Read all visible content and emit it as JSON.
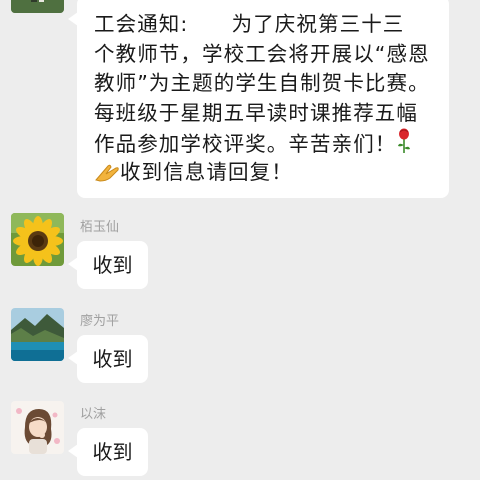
{
  "messages": [
    {
      "sender": "",
      "avatar_icon": "person-outdoor-photo",
      "lines": [
        "工会通知:　　为了庆祝第三十三",
        "个教师节，学校工会将开展以“感恩",
        "教师”为主题的学生自制贺卡比赛。",
        "每班级于星期五早读时课推荐五幅",
        "作品参加学校评奖。辛苦亲们！"
      ],
      "last_line": "收到信息请回复！",
      "emoji_rose": "rose-emoji",
      "emoji_hands": "folded-hands-emoji"
    },
    {
      "sender": "栢玉仙",
      "text": "收到",
      "avatar_icon": "sunflower-avatar"
    },
    {
      "sender": "廖为平",
      "text": "收到",
      "avatar_icon": "lake-landscape-avatar"
    },
    {
      "sender": "以沫",
      "text": "收到",
      "avatar_icon": "cartoon-girl-avatar"
    }
  ],
  "colors": {
    "background": "#ededed",
    "bubble": "#ffffff",
    "sender": "#a0a0a0"
  }
}
